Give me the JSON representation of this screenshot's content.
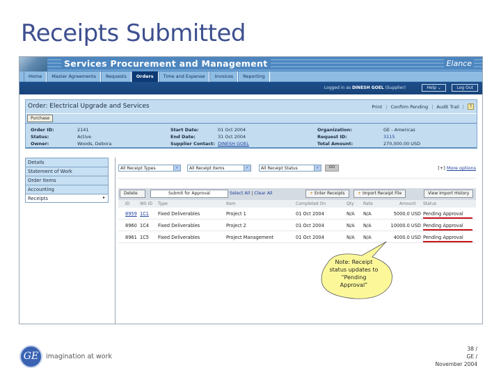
{
  "slide": {
    "title": "Receipts Submitted",
    "tagline": "imagination at work",
    "logo_text": "GE",
    "footer": {
      "page": "38 /",
      "company": "GE /",
      "date": "November 2004"
    }
  },
  "app": {
    "name": "Services Procurement and Management",
    "brand": "Elance",
    "nav_tabs": [
      {
        "label": "Home",
        "active": false
      },
      {
        "label": "Master Agreements",
        "active": false
      },
      {
        "label": "Requests",
        "active": false
      },
      {
        "label": "Orders",
        "active": true
      },
      {
        "label": "Time and Expense",
        "active": false
      },
      {
        "label": "Invoices",
        "active": false
      },
      {
        "label": "Reporting",
        "active": false
      }
    ],
    "logged_in_prefix": "Logged in as",
    "user": "DINESH GOEL",
    "role": "(Supplier)",
    "help_label": "Help",
    "logout_label": "Log Out"
  },
  "order": {
    "title": "Order:  Electrical Upgrade and Services",
    "actions": [
      "Print",
      "Confirm Pending",
      "Audit Trail"
    ],
    "help_icon": "?",
    "purchase_label": "Purchase",
    "fields": {
      "order_id_label": "Order ID:",
      "order_id": "2141",
      "status_label": "Status:",
      "status": "Active",
      "owner_label": "Owner:",
      "owner": "Woods, Debora",
      "start_label": "Start Date:",
      "start": "01 Oct 2004",
      "end_label": "End Date:",
      "end": "31 Oct 2004",
      "contact_label": "Supplier Contact:",
      "contact": "DINESH GOEL",
      "org_label": "Organization:",
      "org": "GE - Americas",
      "request_label": "Request ID:",
      "request": "3115",
      "total_label": "Total Amount:",
      "total": "270,000.00 USD"
    }
  },
  "sidenav": [
    {
      "label": "Details"
    },
    {
      "label": "Statement of Work"
    },
    {
      "label": "Order Items"
    },
    {
      "label": "Accounting"
    },
    {
      "label": "Receipts",
      "arrow": "▸"
    }
  ],
  "filters": {
    "receipt_types": "All Receipt Types",
    "receipt_items": "All Receipt Items",
    "receipt_status": "All Receipt Status",
    "go_label": "GO",
    "more_prefix": "[+]",
    "more_label": "More options"
  },
  "toolbar": {
    "delete_label": "Delete",
    "submit_label": "Submit for Approval",
    "select_all": "Select All",
    "clear_all": "Clear All",
    "enter_receipts": "Enter Receipts",
    "import_file": "Import Receipt File",
    "view_history": "View Import History"
  },
  "table": {
    "columns": [
      "ID",
      "WS ID",
      "Type",
      "Item",
      "Completed On",
      "Qty",
      "Rate",
      "Amount",
      "Status"
    ],
    "rows": [
      {
        "id": "8959",
        "ws_id": "1C1",
        "type": "Fixed Deliverables",
        "item": "Project 1",
        "completed": "01 Oct 2004",
        "qty": "N/A",
        "rate": "N/A",
        "amount": "5000.0 USD",
        "status": "Pending Approval"
      },
      {
        "id": "8960",
        "ws_id": "1C4",
        "type": "Fixed Deliverables",
        "item": "Project 2",
        "completed": "01 Oct 2004",
        "qty": "N/A",
        "rate": "N/A",
        "amount": "10000.0 USD",
        "status": "Pending Approval"
      },
      {
        "id": "8961",
        "ws_id": "1C5",
        "type": "Fixed Deliverables",
        "item": "Project Management",
        "completed": "01 Oct 2004",
        "qty": "N/A",
        "rate": "N/A",
        "amount": "4000.0 USD",
        "status": "Pending Approval"
      }
    ]
  },
  "callout": {
    "text_lines": [
      "Note: Receipt",
      "status updates to",
      "“Pending",
      "Approval”"
    ],
    "fill": "#fcf89a",
    "highlight_color": "#c8111a"
  }
}
